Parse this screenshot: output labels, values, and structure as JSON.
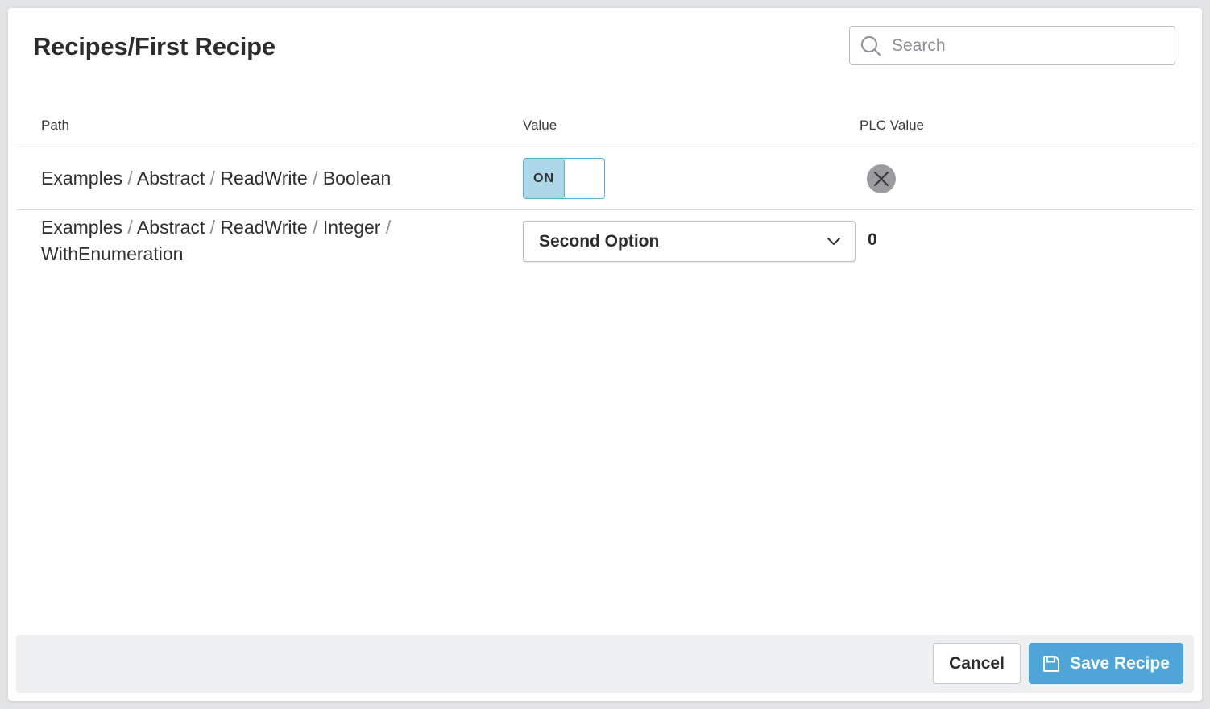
{
  "dialog": {
    "title": "Recipes/First Recipe",
    "search": {
      "placeholder": "Search",
      "value": ""
    }
  },
  "table": {
    "headers": {
      "path": "Path",
      "value": "Value",
      "plc_value": "PLC Value"
    },
    "rows": [
      {
        "path_parts": [
          "Examples",
          "Abstract",
          "ReadWrite",
          "Boolean"
        ],
        "value": {
          "type": "toggle",
          "label": "ON",
          "checked": true
        },
        "plc_value": {
          "type": "icon",
          "icon": "close-circle-icon"
        }
      },
      {
        "path_parts": [
          "Examples",
          "Abstract",
          "ReadWrite",
          "Integer",
          "WithEnumeration"
        ],
        "value": {
          "type": "select",
          "selected": "Second Option"
        },
        "plc_value": {
          "type": "text",
          "text": "0"
        }
      }
    ]
  },
  "footer": {
    "cancel_label": "Cancel",
    "save_label": "Save Recipe"
  },
  "colors": {
    "accent": "#4ea6d8",
    "toggle_on": "#add8e9",
    "footer_bg": "#eeeff1"
  },
  "icons": {
    "search": "search-icon",
    "dropdown": "chevron-down-icon",
    "save": "save-icon",
    "plc_missing": "close-circle-icon"
  }
}
